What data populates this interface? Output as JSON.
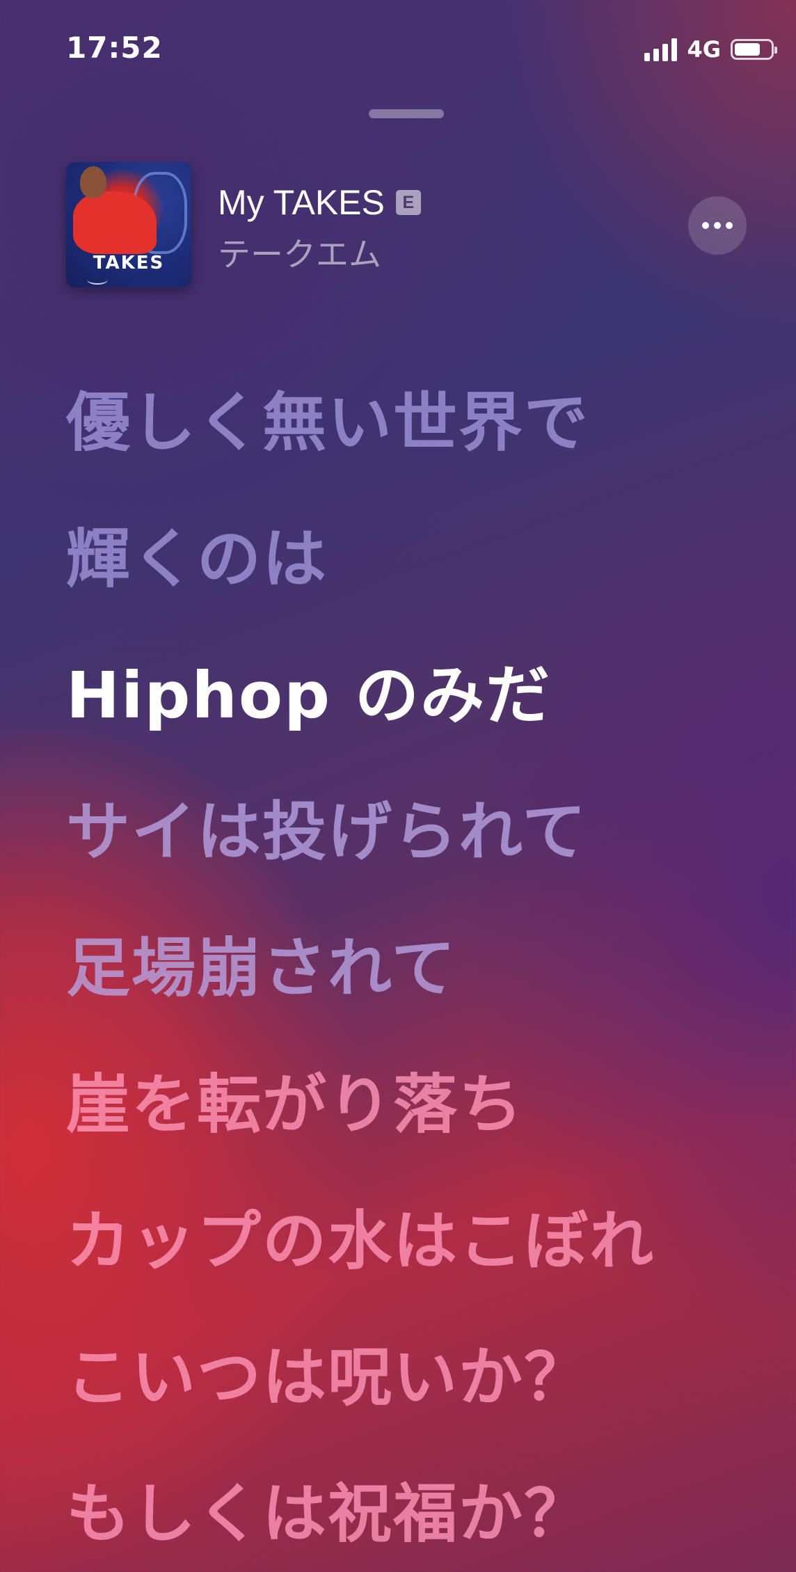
{
  "status_bar": {
    "time": "17:52",
    "network": "4G"
  },
  "now_playing": {
    "title": "My TAKES",
    "explicit_badge": "E",
    "artist": "テークエム",
    "artwork_text": "TAKES"
  },
  "lyrics": {
    "lines": [
      "優しく無い世界で",
      "輝くのは",
      "Hiphop のみだ",
      "サイは投げられて",
      "足場崩されて",
      "崖を転がり落ち",
      "カップの水はこぼれ",
      "こいつは呪いか？",
      "もしくは祝福か？"
    ],
    "current_index": 2
  },
  "colors": {
    "current_lyric": "#ffffff",
    "past_lyric": "#aaa0e6",
    "upcoming_lyric": "#ff96b9",
    "background_top": "#4a3270",
    "background_red": "#d63036"
  },
  "icons": {
    "more": "ellipsis-icon",
    "signal": "cellular-signal-icon",
    "battery": "battery-icon"
  }
}
